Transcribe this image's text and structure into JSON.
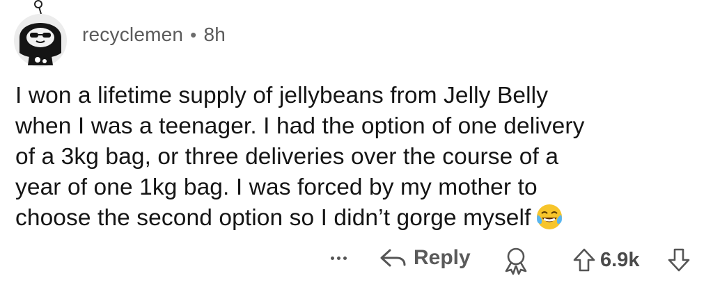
{
  "comment": {
    "username": "recyclemen",
    "separator": "•",
    "time_ago": "8h",
    "lines": [
      "I won a lifetime supply of jellybeans from Jelly Belly",
      "when I was a teenager. I had the option of one delivery",
      "of a 3kg bag, or three deliveries over the course of a",
      "year of one 1kg bag. I was forced by my mother to",
      "choose the second option so I didn’t gorge myself"
    ],
    "emoji": "face-with-tears-of-joy"
  },
  "actions": {
    "more_icon": "ellipsis-icon",
    "reply_label": "Reply",
    "award_icon": "award-icon",
    "upvote_icon": "arrow-up-icon",
    "score": "6.9k",
    "downvote_icon": "arrow-down-icon"
  },
  "colors": {
    "text": "#151515",
    "meta": "#5a5a5a",
    "emoji": "#f7c52b"
  }
}
